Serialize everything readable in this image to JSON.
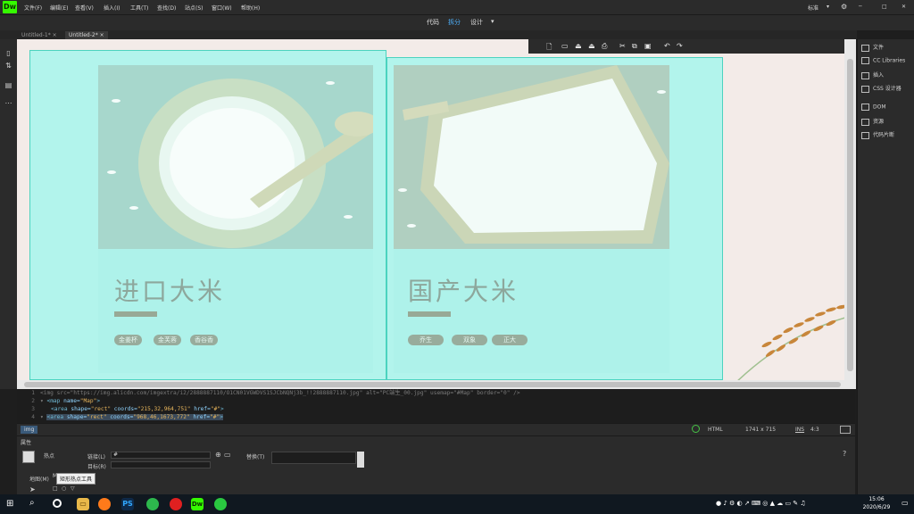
{
  "app": {
    "logo": "Dw",
    "workspace": "标准",
    "workspace_arrow": "▾"
  },
  "menu": [
    "文件(F)",
    "编辑(E)",
    "查看(V)",
    "插入(I)",
    "工具(T)",
    "查找(D)",
    "站点(S)",
    "窗口(W)",
    "帮助(H)"
  ],
  "view_modes": {
    "code": "代码",
    "split": "拆分",
    "design": "设计",
    "arrow": "▾"
  },
  "window_controls": {
    "minimize": "─",
    "maximize": "□",
    "close": "✕"
  },
  "doc_tabs": [
    {
      "label": "Untitled-1*",
      "close": "×"
    },
    {
      "label": "Untitled-2*",
      "close": "×"
    }
  ],
  "right_panel": [
    "文件",
    "CC Libraries",
    "插入",
    "CSS 设计器",
    "DOM",
    "资源",
    "代码片断"
  ],
  "cards": [
    {
      "title": "进口大米",
      "tags": [
        "金姜杯",
        "金芙蓉",
        "香谷香"
      ]
    },
    {
      "title": "国产大米",
      "tags": [
        "乔生",
        "双象",
        "正大"
      ]
    }
  ],
  "code_lines": [
    {
      "num": "1",
      "text": "<img src=\"https://img.alicdn.com/imgextra/i2/2888887110/O1CN01VGWDVS1SJCbNQNj3b_!!2888887110.jpg\" alt=\"PC端生_00.jpg\" usemap=\"#Map\" border=\"0\" />"
    },
    {
      "num": "2",
      "fold": "▾",
      "tag": "<map",
      "attr": " name=",
      "val": "\"Map\"",
      "end": ">"
    },
    {
      "num": "3",
      "tag": "<area",
      "attr": " shape=",
      "val": "\"rect\"",
      "attr2": " coords=",
      "val2": "\"215,32,964,751\"",
      "attr3": " href=",
      "val3": "\"#\"",
      "end": ">"
    },
    {
      "num": "4",
      "fold": "▾",
      "tag": "<area",
      "attr": " shape=",
      "val": "\"rect\"",
      "attr2": " coords=",
      "val2": "\"968,46,1673,772\"",
      "attr3": " href=",
      "val3": "\"#\"",
      "end": ">"
    }
  ],
  "status": {
    "tag": "img",
    "doc_type": "HTML",
    "dimensions": "1741 x 715",
    "mode": "INS",
    "position": "4:3"
  },
  "properties": {
    "header": "属性",
    "hotspot_label": "热点",
    "link_label": "链接(L)",
    "link_value": "#",
    "target_label": "目标(R)",
    "alt_label": "替换(T)",
    "map_label": "地图(M)",
    "map_value": "Map",
    "tooltip": "矩形热点工具"
  },
  "taskbar": {
    "time": "15:06",
    "date": "2020/6/29",
    "apps": [
      "PS",
      "Dw"
    ]
  }
}
